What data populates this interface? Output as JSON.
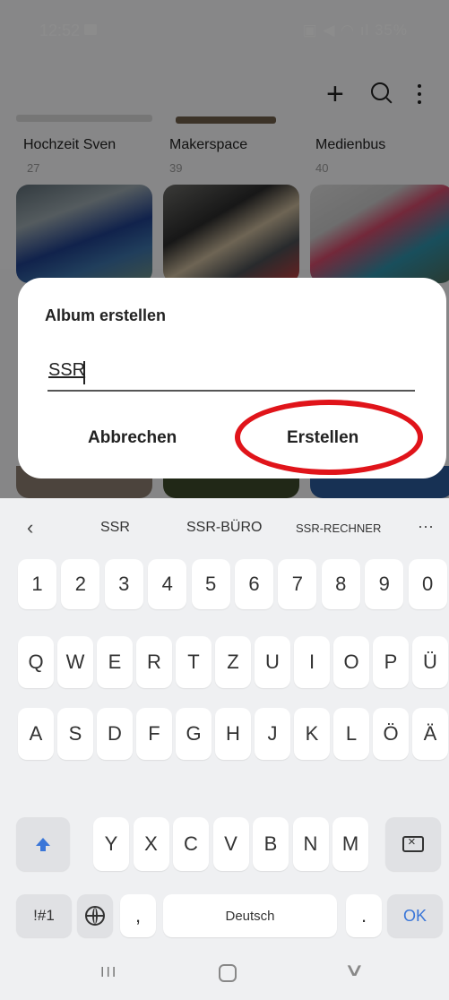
{
  "status_bar": {
    "time": "12:52",
    "battery": "35%"
  },
  "toolbar": {
    "add_icon": "plus-icon",
    "search_icon": "search-icon",
    "more_icon": "more-vert-icon"
  },
  "albums": [
    {
      "title": "Hochzeit Sven",
      "count": "27"
    },
    {
      "title": "Makerspace",
      "count": "39"
    },
    {
      "title": "Medienbus",
      "count": "40"
    }
  ],
  "dialog": {
    "title": "Album erstellen",
    "input_value": "SSR",
    "cancel_label": "Abbrechen",
    "create_label": "Erstellen"
  },
  "suggestions": [
    "SSR",
    "SSR-BÜRO",
    "SSR-RECHNER"
  ],
  "keyboard": {
    "number_row": [
      "1",
      "2",
      "3",
      "4",
      "5",
      "6",
      "7",
      "8",
      "9",
      "0"
    ],
    "row1": [
      "Q",
      "W",
      "E",
      "R",
      "T",
      "Z",
      "U",
      "I",
      "O",
      "P",
      "Ü"
    ],
    "row2": [
      "A",
      "S",
      "D",
      "F",
      "G",
      "H",
      "J",
      "K",
      "L",
      "Ö",
      "Ä"
    ],
    "row3": [
      "Y",
      "X",
      "C",
      "V",
      "B",
      "N",
      "M"
    ],
    "symbols_label": "!#1",
    "comma_label": ",",
    "space_label": "Deutsch",
    "period_label": ".",
    "ok_label": "OK"
  },
  "colors": {
    "accent": "#3a76d8",
    "highlight_ring": "#e0141a"
  }
}
